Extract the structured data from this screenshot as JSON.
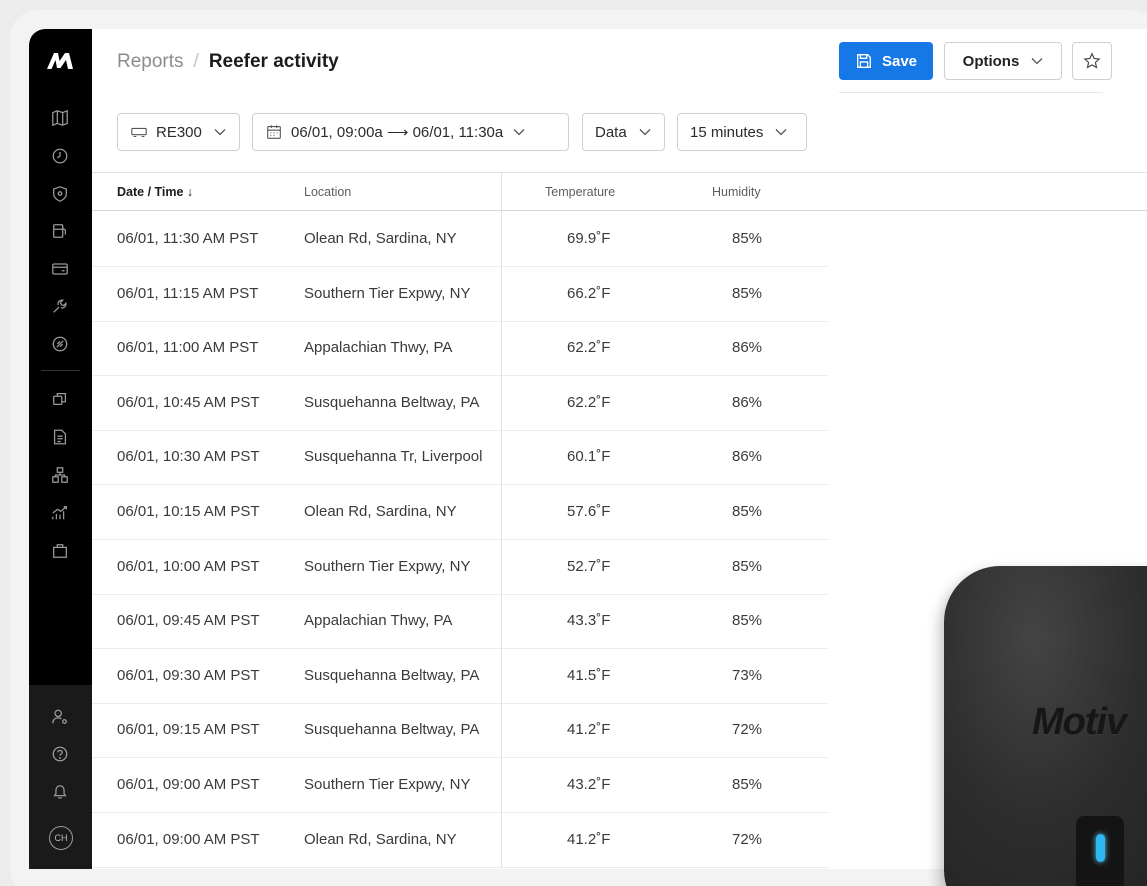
{
  "breadcrumb": {
    "root": "Reports",
    "current": "Reefer activity"
  },
  "toolbar": {
    "save_label": "Save",
    "options_label": "Options"
  },
  "filters": {
    "vehicle": "RE300",
    "date_range": "06/01, 09:00a ⟶ 06/01, 11:30a",
    "view": "Data",
    "interval": "15 minutes"
  },
  "table": {
    "headers": {
      "datetime": "Date / Time ↓",
      "location": "Location",
      "temperature": "Temperature",
      "humidity": "Humidity"
    },
    "rows": [
      {
        "datetime": "06/01, 11:30 AM PST",
        "location": "Olean Rd, Sardina, NY",
        "temperature": "69.9˚F",
        "humidity": "85%"
      },
      {
        "datetime": "06/01, 11:15 AM PST",
        "location": "Southern Tier Expwy, NY",
        "temperature": "66.2˚F",
        "humidity": "85%"
      },
      {
        "datetime": "06/01, 11:00 AM PST",
        "location": "Appalachian Thwy, PA",
        "temperature": "62.2˚F",
        "humidity": "86%"
      },
      {
        "datetime": "06/01, 10:45 AM PST",
        "location": "Susquehanna Beltway, PA",
        "temperature": "62.2˚F",
        "humidity": "86%"
      },
      {
        "datetime": "06/01, 10:30 AM PST",
        "location": "Susquehanna Tr, Liverpool",
        "temperature": "60.1˚F",
        "humidity": "86%"
      },
      {
        "datetime": "06/01, 10:15 AM PST",
        "location": "Olean Rd, Sardina, NY",
        "temperature": "57.6˚F",
        "humidity": "85%"
      },
      {
        "datetime": "06/01, 10:00 AM PST",
        "location": "Southern Tier Expwy, NY",
        "temperature": "52.7˚F",
        "humidity": "85%"
      },
      {
        "datetime": "06/01, 09:45 AM PST",
        "location": "Appalachian Thwy, PA",
        "temperature": "43.3˚F",
        "humidity": "85%"
      },
      {
        "datetime": "06/01, 09:30 AM PST",
        "location": "Susquehanna Beltway, PA",
        "temperature": "41.5˚F",
        "humidity": "73%"
      },
      {
        "datetime": "06/01, 09:15 AM PST",
        "location": "Susquehanna Beltway, PA",
        "temperature": "41.2˚F",
        "humidity": "72%"
      },
      {
        "datetime": "06/01, 09:00 AM PST",
        "location": "Southern Tier Expwy, NY",
        "temperature": "43.2˚F",
        "humidity": "85%"
      },
      {
        "datetime": "06/01, 09:00 AM PST",
        "location": "Olean Rd, Sardina, NY",
        "temperature": "41.2˚F",
        "humidity": "72%"
      }
    ]
  },
  "sidebar": {
    "icons": [
      "map-icon",
      "clock-icon",
      "shield-icon",
      "fuel-icon",
      "card-icon",
      "wrench-icon",
      "tag-icon",
      "copy-icon",
      "document-icon",
      "org-chart-icon",
      "analytics-icon",
      "bag-icon",
      "user-settings-icon",
      "help-icon",
      "bell-icon"
    ],
    "avatar_initials": "CH"
  },
  "device": {
    "brand": "Motiv"
  },
  "colors": {
    "primary": "#1677e6",
    "sidebar": "#000000",
    "led": "#2fb7f2"
  }
}
